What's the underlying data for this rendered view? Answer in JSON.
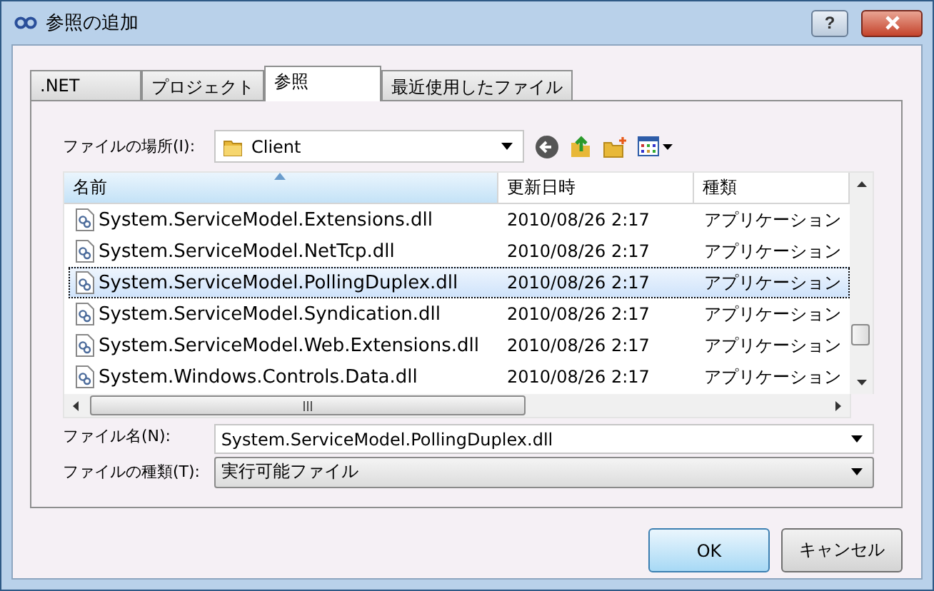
{
  "window": {
    "title": "参照の追加",
    "help_button": "?"
  },
  "tabs": [
    {
      "label": ".NET",
      "selected": false
    },
    {
      "label": "プロジェクト",
      "selected": false
    },
    {
      "label": "参照",
      "selected": true
    },
    {
      "label": "最近使用したファイル",
      "selected": false
    }
  ],
  "location": {
    "label": "ファイルの場所(I):",
    "value": "Client"
  },
  "table": {
    "columns": [
      "名前",
      "更新日時",
      "種類"
    ],
    "rows": [
      {
        "name": "System.ServiceModel.Extensions.dll",
        "modified": "2010/08/26 2:17",
        "type": "アプリケーション",
        "selected": false
      },
      {
        "name": "System.ServiceModel.NetTcp.dll",
        "modified": "2010/08/26 2:17",
        "type": "アプリケーション",
        "selected": false
      },
      {
        "name": "System.ServiceModel.PollingDuplex.dll",
        "modified": "2010/08/26 2:17",
        "type": "アプリケーション",
        "selected": true
      },
      {
        "name": "System.ServiceModel.Syndication.dll",
        "modified": "2010/08/26 2:17",
        "type": "アプリケーション",
        "selected": false
      },
      {
        "name": "System.ServiceModel.Web.Extensions.dll",
        "modified": "2010/08/26 2:17",
        "type": "アプリケーション",
        "selected": false
      },
      {
        "name": "System.Windows.Controls.Data.dll",
        "modified": "2010/08/26 2:17",
        "type": "アプリケーション",
        "selected": false
      }
    ]
  },
  "file_name": {
    "label": "ファイル名(N):",
    "value": "System.ServiceModel.PollingDuplex.dll"
  },
  "file_type": {
    "label": "ファイルの種類(T):",
    "value": "実行可能ファイル"
  },
  "buttons": [
    {
      "label": "OK",
      "default": true
    },
    {
      "label": "キャンセル",
      "default": false
    }
  ]
}
